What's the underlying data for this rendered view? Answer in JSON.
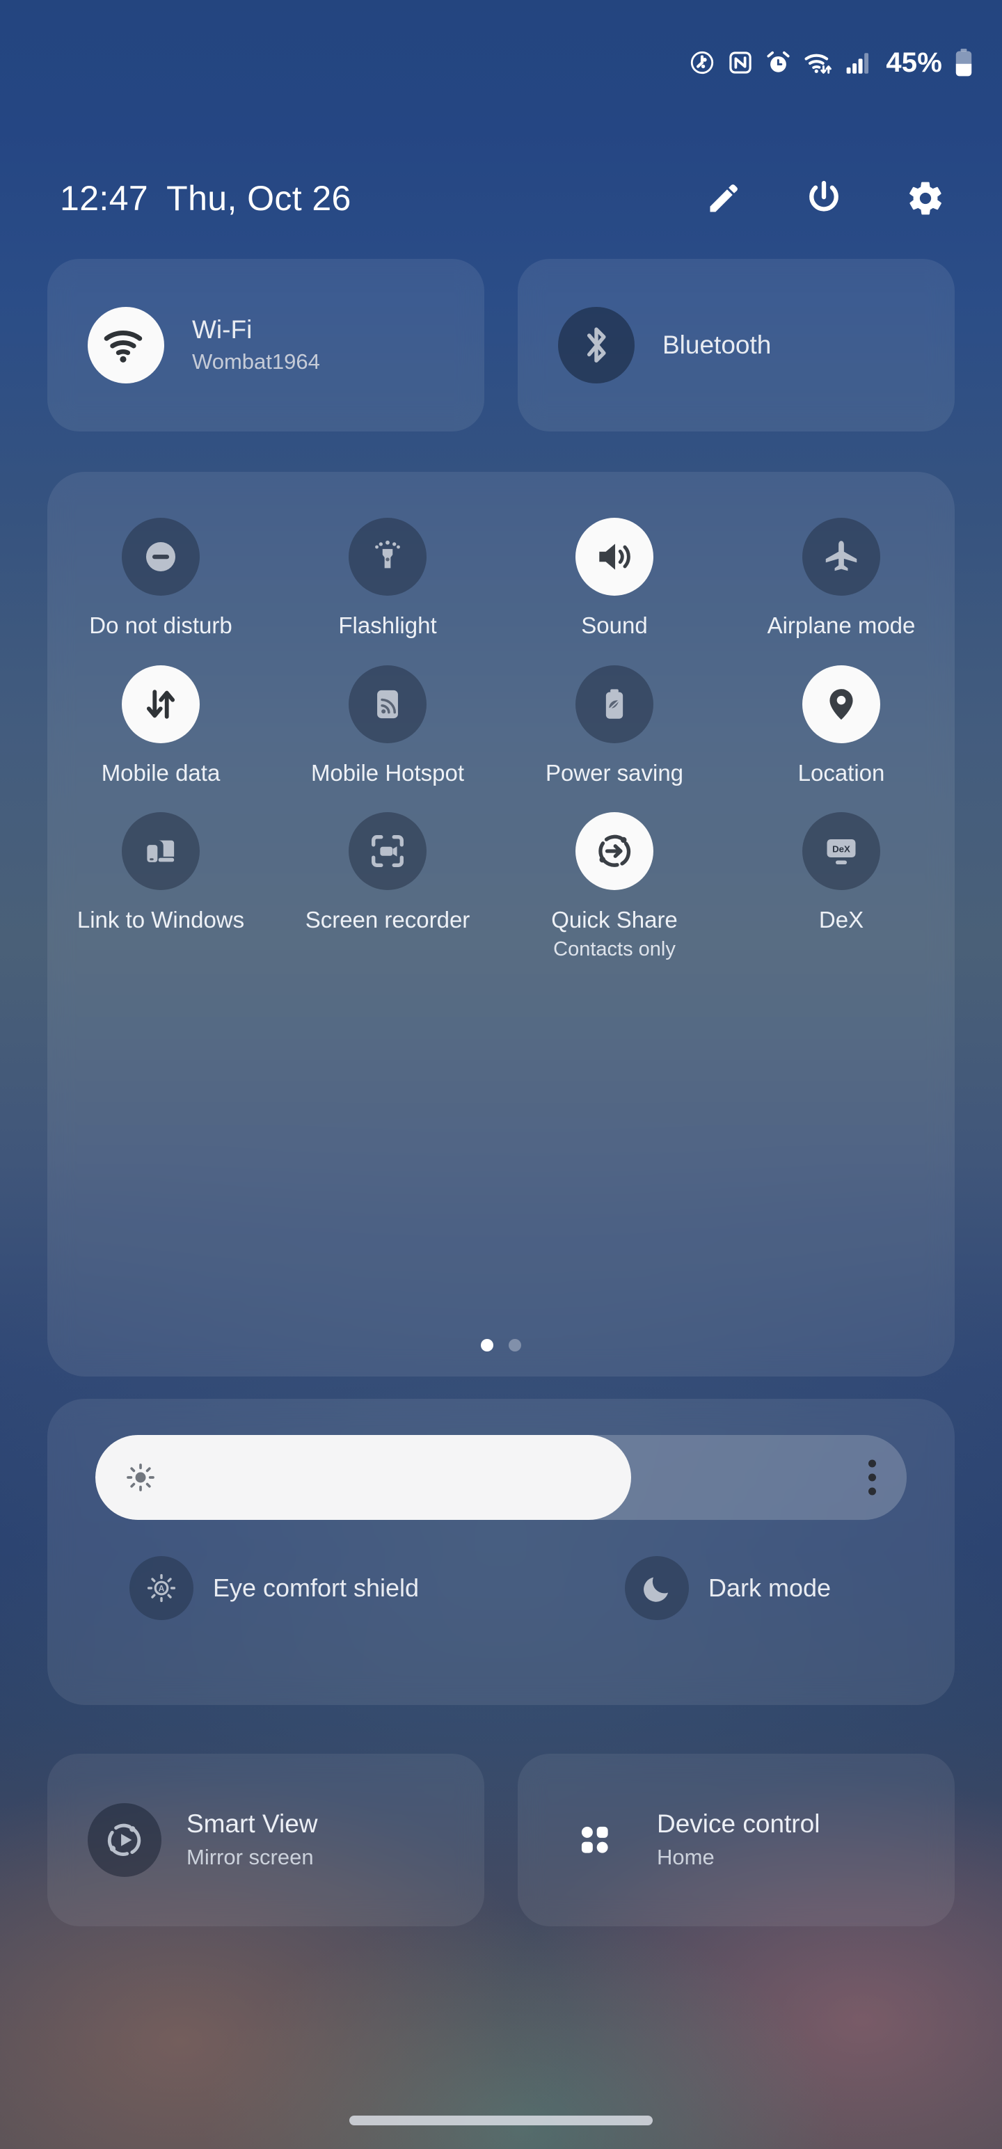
{
  "statusbar": {
    "icons": [
      "data-saver-icon",
      "nfc-icon",
      "alarm-icon",
      "wifi-icon",
      "signal-icon"
    ],
    "battery_percent": "45%",
    "battery_icon": "battery-icon"
  },
  "header": {
    "time": "12:47",
    "date": "Thu, Oct 26",
    "actions": [
      {
        "name": "edit-icon",
        "label": "Edit"
      },
      {
        "name": "power-icon",
        "label": "Power off"
      },
      {
        "name": "settings-gear-icon",
        "label": "Settings"
      }
    ]
  },
  "connectivity": [
    {
      "title": "Wi-Fi",
      "subtitle": "Wombat1964",
      "icon": "wifi-icon",
      "state": "on"
    },
    {
      "title": "Bluetooth",
      "subtitle": "",
      "icon": "bluetooth-icon",
      "state": "off"
    }
  ],
  "tiles": [
    {
      "label": "Do not disturb",
      "sub": "",
      "icon": "do-not-disturb-icon",
      "state": "off"
    },
    {
      "label": "Flashlight",
      "sub": "",
      "icon": "flashlight-icon",
      "state": "off"
    },
    {
      "label": "Sound",
      "sub": "",
      "icon": "sound-icon",
      "state": "on"
    },
    {
      "label": "Airplane mode",
      "sub": "",
      "icon": "airplane-icon",
      "state": "off"
    },
    {
      "label": "Mobile data",
      "sub": "",
      "icon": "mobile-data-icon",
      "state": "on"
    },
    {
      "label": "Mobile Hotspot",
      "sub": "",
      "icon": "hotspot-icon",
      "state": "off"
    },
    {
      "label": "Power saving",
      "sub": "",
      "icon": "power-saving-icon",
      "state": "off"
    },
    {
      "label": "Location",
      "sub": "",
      "icon": "location-pin-icon",
      "state": "on"
    },
    {
      "label": "Link to Windows",
      "sub": "",
      "icon": "link-to-windows-icon",
      "state": "off"
    },
    {
      "label": "Screen recorder",
      "sub": "",
      "icon": "screen-recorder-icon",
      "state": "off"
    },
    {
      "label": "Quick Share",
      "sub": "Contacts only",
      "icon": "quick-share-icon",
      "state": "on"
    },
    {
      "label": "DeX",
      "sub": "",
      "icon": "dex-icon",
      "state": "off"
    }
  ],
  "pager": {
    "total": 2,
    "current": 1
  },
  "brightness": {
    "value_percent": 66,
    "sun_icon": "brightness-sun-icon",
    "menu_icon": "more-options-icon",
    "options": [
      {
        "label": "Eye comfort shield",
        "icon": "eye-comfort-shield-icon",
        "state": "off"
      },
      {
        "label": "Dark mode",
        "icon": "dark-mode-moon-icon",
        "state": "off"
      }
    ]
  },
  "bottom_cards": [
    {
      "title": "Smart View",
      "subtitle": "Mirror screen",
      "icon": "smart-view-icon"
    },
    {
      "title": "Device control",
      "subtitle": "Home",
      "icon": "device-control-grid-icon"
    }
  ],
  "colors": {
    "accent_on": "#fafafa",
    "icon_on_fg": "#2f3337",
    "icon_off_fg": "#b9c0cc",
    "text_primary": "#eef1f6",
    "text_secondary": "#c6ccd8"
  }
}
